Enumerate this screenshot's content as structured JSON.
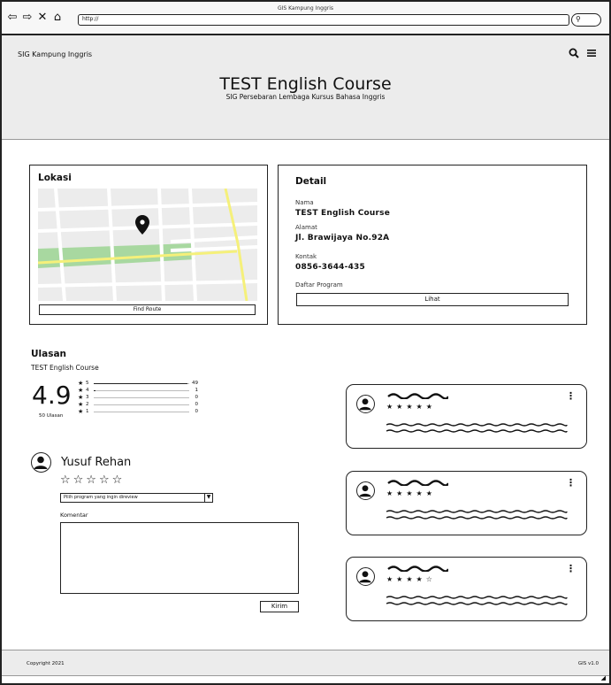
{
  "window": {
    "title": "GIS Kampung Inggris",
    "url": "http://",
    "nav_icons": [
      "back-arrow-icon",
      "forward-arrow-icon",
      "close-icon",
      "home-icon"
    ]
  },
  "header": {
    "brand": "SIG Kampung Inggris",
    "title": "TEST English Course",
    "subtitle": "SIG Persebaran Lembaga Kursus Bahasa Inggris",
    "icons": [
      "search-icon",
      "hamburger-menu-icon"
    ]
  },
  "location": {
    "heading": "Lokasi",
    "route_button": "Find Route"
  },
  "detail": {
    "heading": "Detail",
    "fields": [
      {
        "label": "Nama",
        "value": "TEST English Course"
      },
      {
        "label": "Alamat",
        "value": "Jl. Brawijaya No.92A"
      },
      {
        "label": "Kontak",
        "value": "0856-3644-435"
      }
    ],
    "program_label": "Daftar Program",
    "program_button": "Lihat"
  },
  "reviews": {
    "heading": "Ulasan",
    "course_name": "TEST English Course",
    "average": "4.9",
    "count_label": "50 Ulasan",
    "distribution": [
      {
        "stars": "5",
        "count": "49",
        "fraction": 0.98
      },
      {
        "stars": "4",
        "count": "1",
        "fraction": 0.02
      },
      {
        "stars": "3",
        "count": "0",
        "fraction": 0
      },
      {
        "stars": "2",
        "count": "0",
        "fraction": 0
      },
      {
        "stars": "1",
        "count": "0",
        "fraction": 0
      }
    ]
  },
  "compose": {
    "user_name": "Yusuf Rehan",
    "rating_stars": "☆☆☆☆☆",
    "program_select": "Pilih program yang ingin direview",
    "comment_label": "Komentar",
    "submit_button": "Kirim"
  },
  "review_cards": [
    {
      "rating": 5,
      "stars": "★★★★★"
    },
    {
      "rating": 5,
      "stars": "★★★★★"
    },
    {
      "rating": 4,
      "stars": "★★★★☆"
    }
  ],
  "footer": {
    "copyright": "Copyright 2021",
    "version": "GIS v1.0"
  },
  "colors": {
    "header_bg": "#ececec",
    "footer_bg": "#ececec",
    "map_bg": "#ececec",
    "map_park": "#a8d8a0",
    "map_road_major": "#f5f07a"
  }
}
